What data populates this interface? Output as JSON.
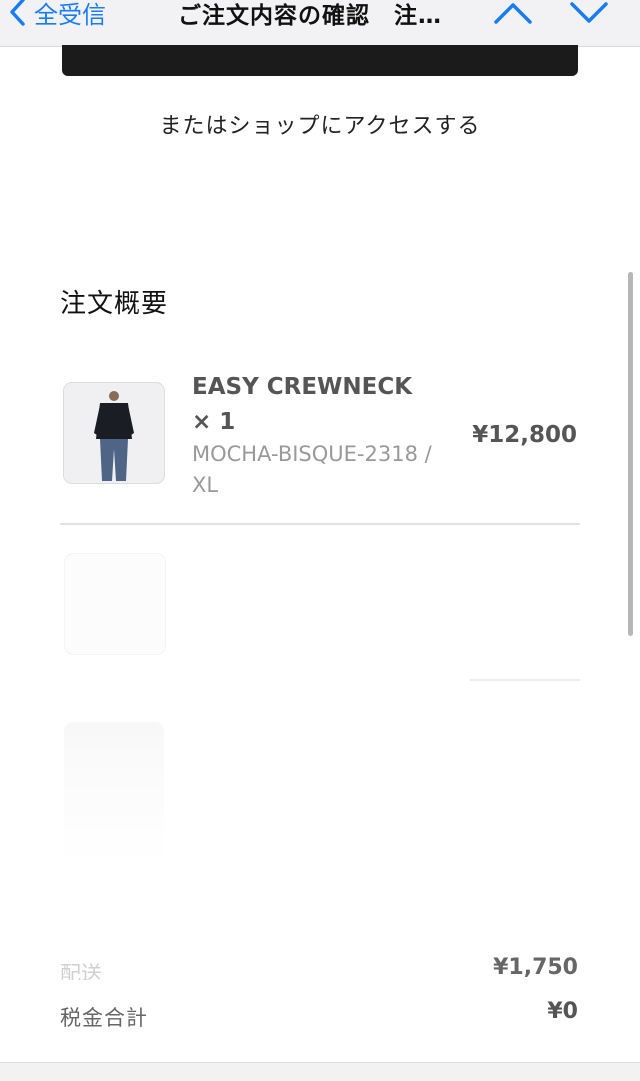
{
  "header": {
    "back_label": "全受信",
    "title": "ご注文内容の確認　注…"
  },
  "shop_link": "またはショップにアクセスする",
  "summary": {
    "title": "注文概要",
    "items": [
      {
        "name": "EASY CREWNECK × 1",
        "variant": "MOCHA-BISQUE-2318 / XL",
        "price": "¥12,800"
      }
    ],
    "shipping_label": "配送",
    "shipping_value": "¥1,750",
    "tax_label": "税金合計",
    "tax_value": "¥0"
  },
  "colors": {
    "accent": "#1a7cf3"
  },
  "icons": {
    "back": "chevron-left-icon",
    "prev": "chevron-up-icon",
    "next": "chevron-down-icon"
  }
}
